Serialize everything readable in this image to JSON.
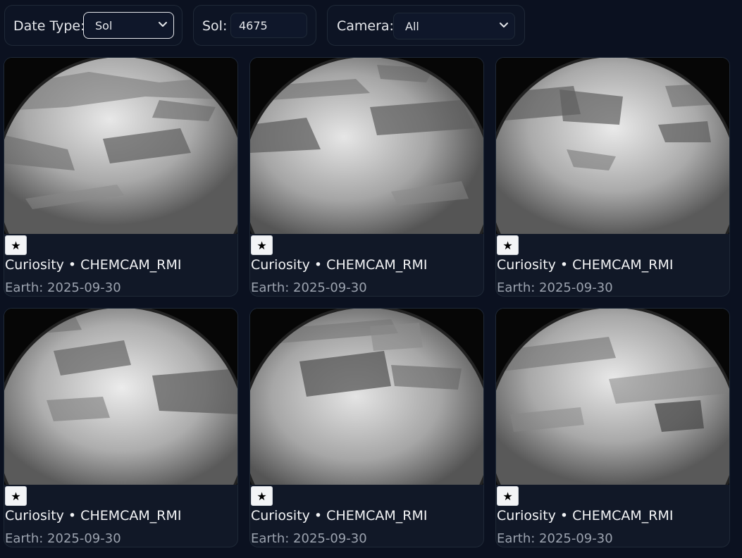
{
  "filters": {
    "date_type": {
      "label": "Date Type:",
      "selected": "Sol"
    },
    "sol": {
      "label": "Sol:",
      "value": "4675"
    },
    "camera": {
      "label": "Camera:",
      "selected": "All"
    }
  },
  "photos": [
    {
      "title": "Curiosity • CHEMCAM_RMI",
      "date": "Earth: 2025-09-30",
      "favorite_icon": "★"
    },
    {
      "title": "Curiosity • CHEMCAM_RMI",
      "date": "Earth: 2025-09-30",
      "favorite_icon": "★"
    },
    {
      "title": "Curiosity • CHEMCAM_RMI",
      "date": "Earth: 2025-09-30",
      "favorite_icon": "★"
    },
    {
      "title": "Curiosity • CHEMCAM_RMI",
      "date": "Earth: 2025-09-30",
      "favorite_icon": "★"
    },
    {
      "title": "Curiosity • CHEMCAM_RMI",
      "date": "Earth: 2025-09-30",
      "favorite_icon": "★"
    },
    {
      "title": "Curiosity • CHEMCAM_RMI",
      "date": "Earth: 2025-09-30",
      "favorite_icon": "★"
    }
  ],
  "colors": {
    "background": "#0b1120",
    "card": "#111827",
    "border": "#1f2937",
    "text": "#e5e7eb",
    "muted": "#9ca3af"
  }
}
